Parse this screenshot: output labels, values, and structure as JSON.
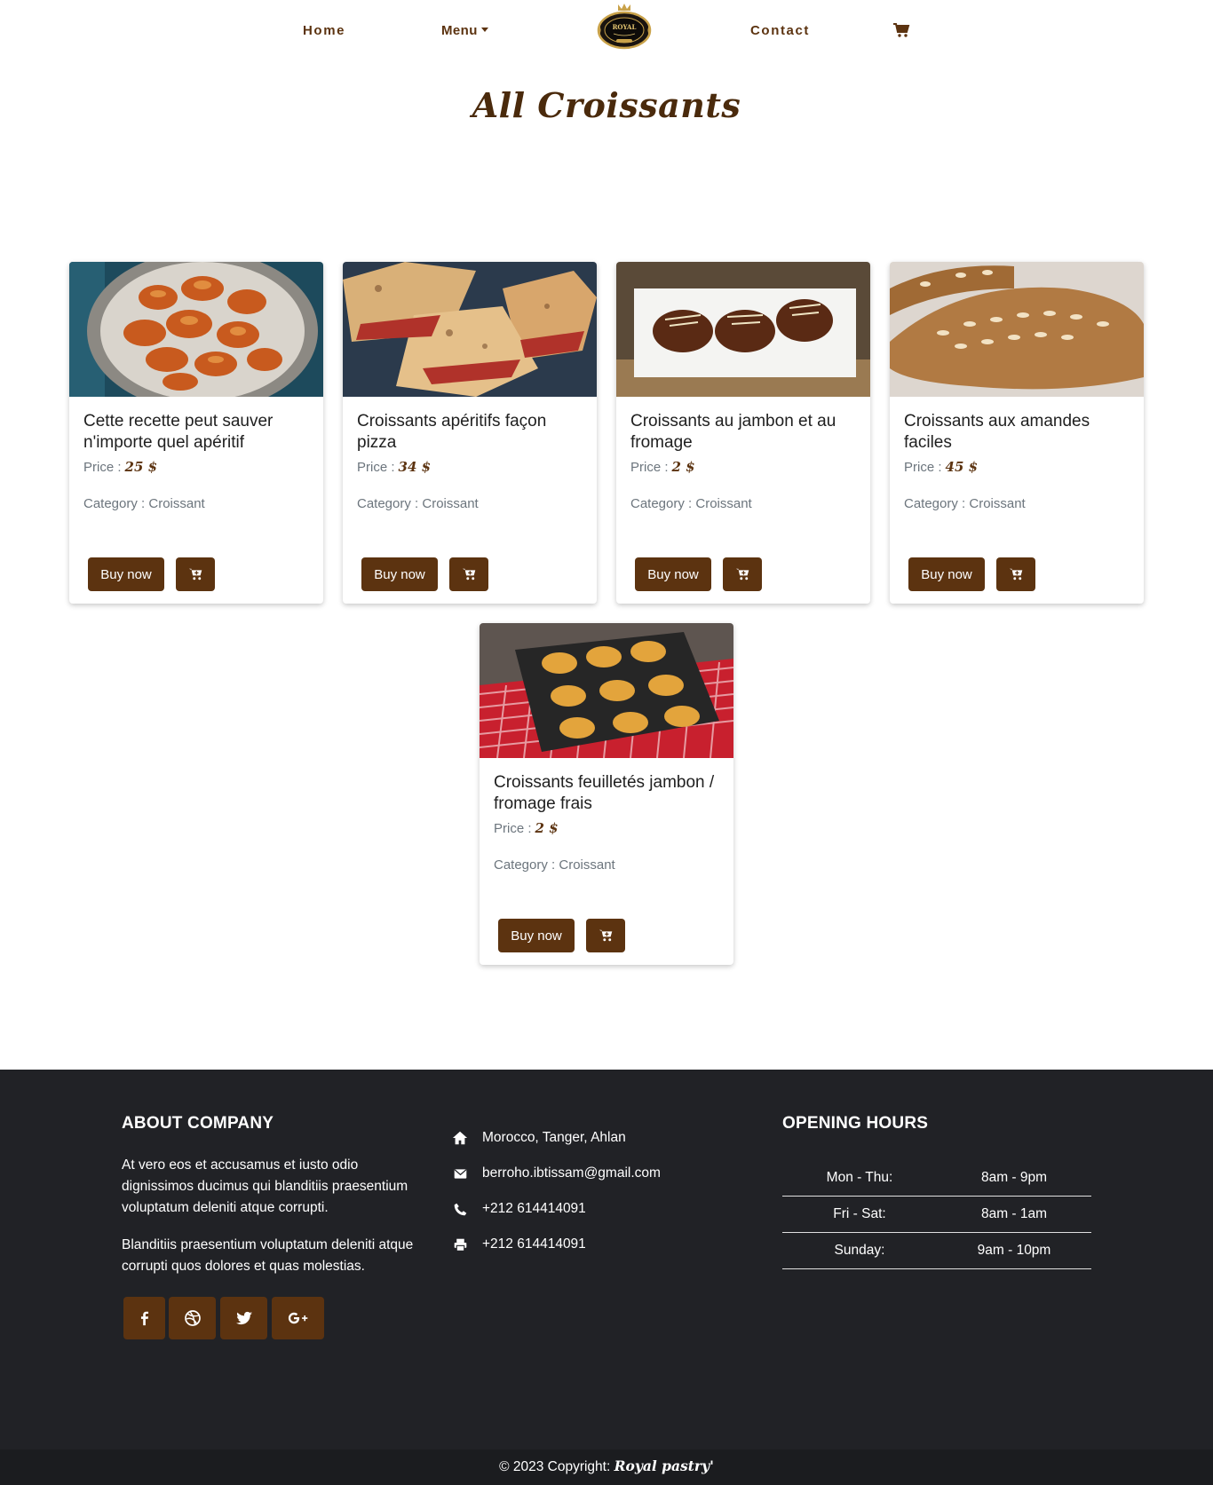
{
  "nav": {
    "home": "Home",
    "menu": "Menu",
    "contact": "Contact",
    "logo_text": "ROYAL"
  },
  "page": {
    "title": "All Croissants"
  },
  "labels": {
    "price": "Price :",
    "category": "Category :",
    "buy": "Buy now"
  },
  "products": [
    {
      "title": "Cette recette peut sauver n'importe quel apéritif",
      "price": "25 $",
      "category": "Croissant"
    },
    {
      "title": "Croissants apéritifs façon pizza",
      "price": "34 $",
      "category": "Croissant"
    },
    {
      "title": "Croissants au jambon et au fromage",
      "price": "2 $",
      "category": "Croissant"
    },
    {
      "title": "Croissants aux amandes faciles",
      "price": "45 $",
      "category": "Croissant"
    },
    {
      "title": "Croissants feuilletés jambon / fromage frais",
      "price": "2 $",
      "category": "Croissant"
    }
  ],
  "footer": {
    "about_title": "ABOUT COMPANY",
    "about_p1": "At vero eos et accusamus et iusto odio dignissimos ducimus qui blanditiis praesentium voluptatum deleniti atque corrupti.",
    "about_p2": "Blanditiis praesentium voluptatum deleniti atque corrupti quos dolores et quas molestias.",
    "address": "Morocco, Tanger, Ahlan",
    "email": "berroho.ibtissam@gmail.com",
    "phone": "+212 614414091",
    "fax": "+212 614414091",
    "hours_title": "OPENING HOURS",
    "hours": [
      {
        "day": "Mon - Thu:",
        "time": "8am - 9pm"
      },
      {
        "day": "Fri - Sat:",
        "time": "8am - 1am"
      },
      {
        "day": "Sunday:",
        "time": "9am - 10pm"
      }
    ],
    "copyright": "© 2023 Copyright:",
    "brand": "Royal pastry'"
  },
  "colors": {
    "brand_brown": "#5c3310",
    "footer_bg": "#212226"
  },
  "icons": [
    "cart-icon",
    "facebook-icon",
    "dribbble-icon",
    "twitter-icon",
    "google-plus-icon",
    "home-icon",
    "envelope-icon",
    "phone-icon",
    "print-icon"
  ]
}
